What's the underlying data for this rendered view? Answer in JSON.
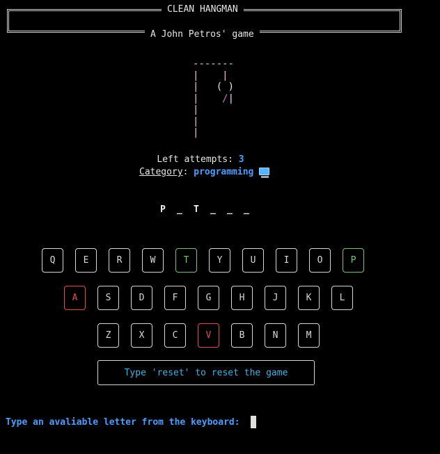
{
  "header": {
    "title": "CLEAN HANGMAN",
    "subtitle": "A John Petros' game"
  },
  "gallows_art": {
    "line1": "-------",
    "line2": "|    |",
    "line3_post": "|   ",
    "line3_head": "( )",
    "line4_post": "|    ",
    "line4_arm": "/",
    "line4_body": "|",
    "line5": "|",
    "line6": "|",
    "line7": "|"
  },
  "status": {
    "attempts_label": "Left attempts: ",
    "attempts_value": "3",
    "category_label": "Category",
    "category_sep": ": ",
    "category_value": "programming",
    "category_icon": "monitor-icon"
  },
  "word": [
    "P",
    "_",
    "T",
    "_",
    "_",
    "_"
  ],
  "keyboard": {
    "row1": [
      {
        "letter": "Q",
        "state": "unused"
      },
      {
        "letter": "E",
        "state": "unused"
      },
      {
        "letter": "R",
        "state": "unused"
      },
      {
        "letter": "W",
        "state": "unused"
      },
      {
        "letter": "T",
        "state": "correct"
      },
      {
        "letter": "Y",
        "state": "unused"
      },
      {
        "letter": "U",
        "state": "unused"
      },
      {
        "letter": "I",
        "state": "unused"
      },
      {
        "letter": "O",
        "state": "unused"
      },
      {
        "letter": "P",
        "state": "correct"
      }
    ],
    "row2": [
      {
        "letter": "A",
        "state": "wrong"
      },
      {
        "letter": "S",
        "state": "unused"
      },
      {
        "letter": "D",
        "state": "unused"
      },
      {
        "letter": "F",
        "state": "unused"
      },
      {
        "letter": "G",
        "state": "unused"
      },
      {
        "letter": "H",
        "state": "unused"
      },
      {
        "letter": "J",
        "state": "unused"
      },
      {
        "letter": "K",
        "state": "unused"
      },
      {
        "letter": "L",
        "state": "unused"
      }
    ],
    "row3": [
      {
        "letter": "Z",
        "state": "unused"
      },
      {
        "letter": "X",
        "state": "unused"
      },
      {
        "letter": "C",
        "state": "unused"
      },
      {
        "letter": "V",
        "state": "wrong"
      },
      {
        "letter": "B",
        "state": "unused"
      },
      {
        "letter": "N",
        "state": "unused"
      },
      {
        "letter": "M",
        "state": "unused"
      }
    ]
  },
  "reset_hint": "Type 'reset' to reset the game",
  "prompt": "Type an avaliable letter from the keyboard:",
  "colors": {
    "correct": "#7cc47c",
    "wrong": "#e05050",
    "accent": "#4a9eff",
    "hint": "#3fb2e8"
  }
}
